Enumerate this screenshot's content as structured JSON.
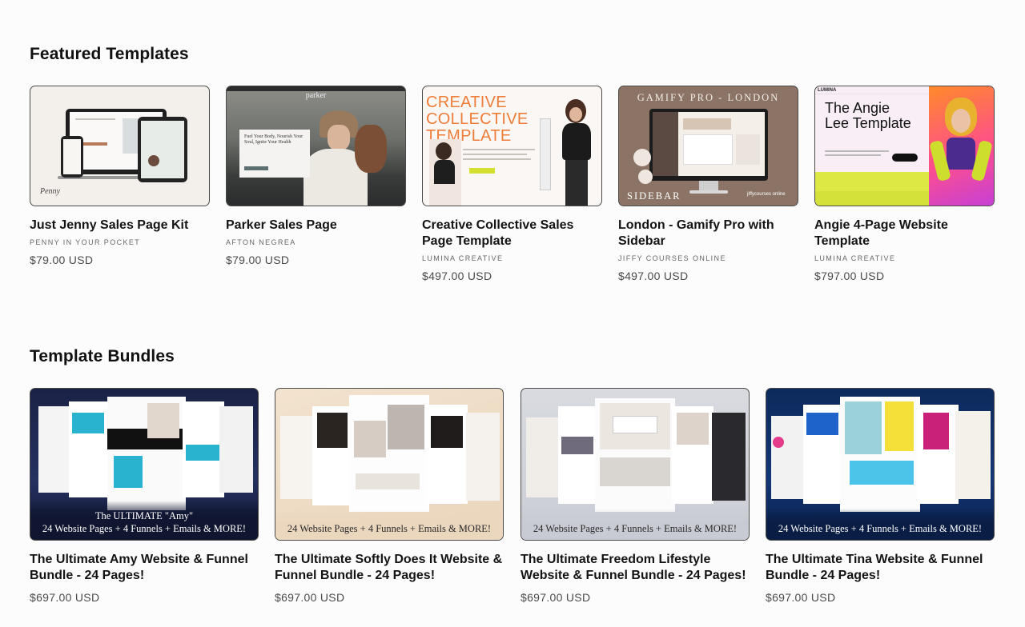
{
  "featured": {
    "title": "Featured Templates",
    "cards": [
      {
        "title": "Just Jenny Sales Page Kit",
        "vendor": "PENNY IN YOUR POCKET",
        "price": "$79.00 USD",
        "thumb_logo": "Penny"
      },
      {
        "title": "Parker Sales Page",
        "vendor": "AFTON NEGREA",
        "price": "$79.00 USD",
        "thumb_brand": "parker",
        "thumb_headline": "Fuel Your Body, Nourish Your Soul, Ignite Your Health"
      },
      {
        "title": "Creative Collective Sales Page Template",
        "vendor": "LUMINA CREATIVE",
        "price": "$497.00 USD",
        "thumb_headline": "CREATIVE COLLECTIVE TEMPLATE"
      },
      {
        "title": "London - Gamify Pro with Sidebar",
        "vendor": "JIFFY COURSES ONLINE",
        "price": "$497.00 USD",
        "thumb_top": "GAMIFY PRO - LONDON",
        "thumb_bottom": "SIDEBAR",
        "thumb_logo": "jiffycourses online"
      },
      {
        "title": "Angie 4-Page Website Template",
        "vendor": "LUMINA CREATIVE",
        "price": "$797.00 USD",
        "thumb_brand": "LUMINA",
        "thumb_headline": "The Angie Lee Template"
      }
    ]
  },
  "bundles": {
    "title": "Template Bundles",
    "cards": [
      {
        "title": "The Ultimate Amy Website & Funnel Bundle - 24 Pages!",
        "price": "$697.00 USD",
        "banner_top": "The ULTIMATE \"Amy\"",
        "banner": "24 Website Pages + 4 Funnels + Emails & MORE!"
      },
      {
        "title": "The Ultimate Softly Does It Website & Funnel Bundle - 24 Pages!",
        "price": "$697.00 USD",
        "banner": "24 Website Pages + 4 Funnels + Emails & MORE!"
      },
      {
        "title": "The Ultimate Freedom Lifestyle Website & Funnel Bundle - 24 Pages!",
        "price": "$697.00 USD",
        "banner": "24 Website Pages + 4 Funnels + Emails & MORE!"
      },
      {
        "title": "The Ultimate Tina Website & Funnel Bundle - 24 Pages!",
        "price": "$697.00 USD",
        "banner": "24 Website Pages + 4 Funnels + Emails & MORE!"
      }
    ]
  },
  "colors": {
    "background": "#fdfcfc",
    "text": "#141414",
    "muted": "#666666",
    "price": "#4a4a4a"
  }
}
